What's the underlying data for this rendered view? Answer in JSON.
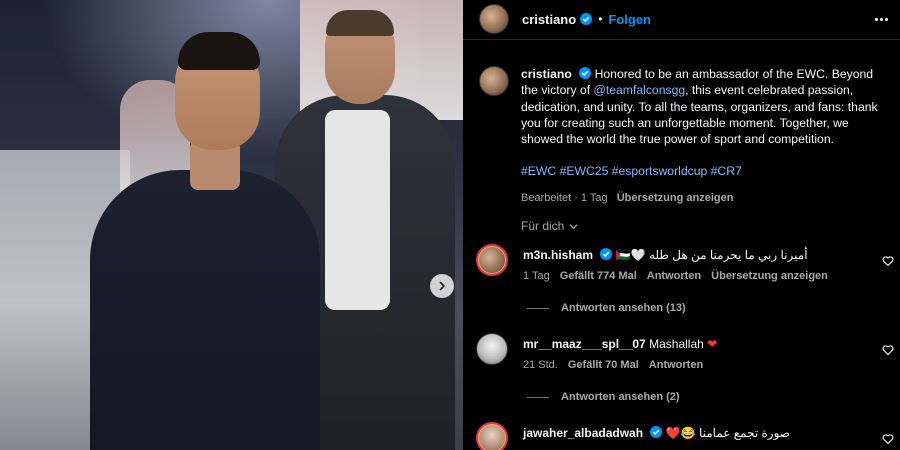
{
  "header": {
    "username": "cristiano",
    "separator": "•",
    "follow_label": "Folgen"
  },
  "caption": {
    "username": "cristiano",
    "text_before_mention": "Honored to be an ambassador of the EWC. Beyond the victory of ",
    "mention": "@teamfalconsgg",
    "text_after_mention": ", this event celebrated passion, dedication, and unity. To all the teams, organizers, and fans: thank you for creating such an unforgettable moment. Together, we showed the world the true power of sport and competition.",
    "hashtags": "#EWC #EWC25 #esportsworldcup #CR7",
    "edited_label": "Bearbeitet · 1 Tag",
    "translate_label": "Übersetzung anzeigen"
  },
  "sort": {
    "label": "Für dich"
  },
  "comments": [
    {
      "username": "m3n.hisham",
      "flag": "🇵🇸🤍",
      "text": "أميرنا ربي ما يحرمنا من هل طله",
      "time": "1 Tag",
      "likes": "Gefällt 774 Mal",
      "reply_label": "Antworten",
      "translate_label": "Übersetzung anzeigen",
      "replies_label": "Antworten ansehen (13)"
    },
    {
      "username": "mr__maaz___spl__07",
      "text": "Mashallah",
      "time": "21 Std.",
      "likes": "Gefällt 70 Mal",
      "reply_label": "Antworten",
      "replies_label": "Antworten ansehen (2)"
    },
    {
      "username": "jawaher_albadadwah",
      "emojis": "❤️😂",
      "text": "صورة تجمع عمامنا"
    }
  ],
  "icons": {
    "verified": "verified-badge-icon",
    "more": "more-options-icon",
    "next": "chevron-right-icon",
    "heart": "heart-outline-icon",
    "chevron": "chevron-down-icon"
  },
  "colors": {
    "accent": "#0095f6",
    "hashtag": "#7fb9ff",
    "background": "#000000",
    "muted": "#a8a8a8"
  }
}
